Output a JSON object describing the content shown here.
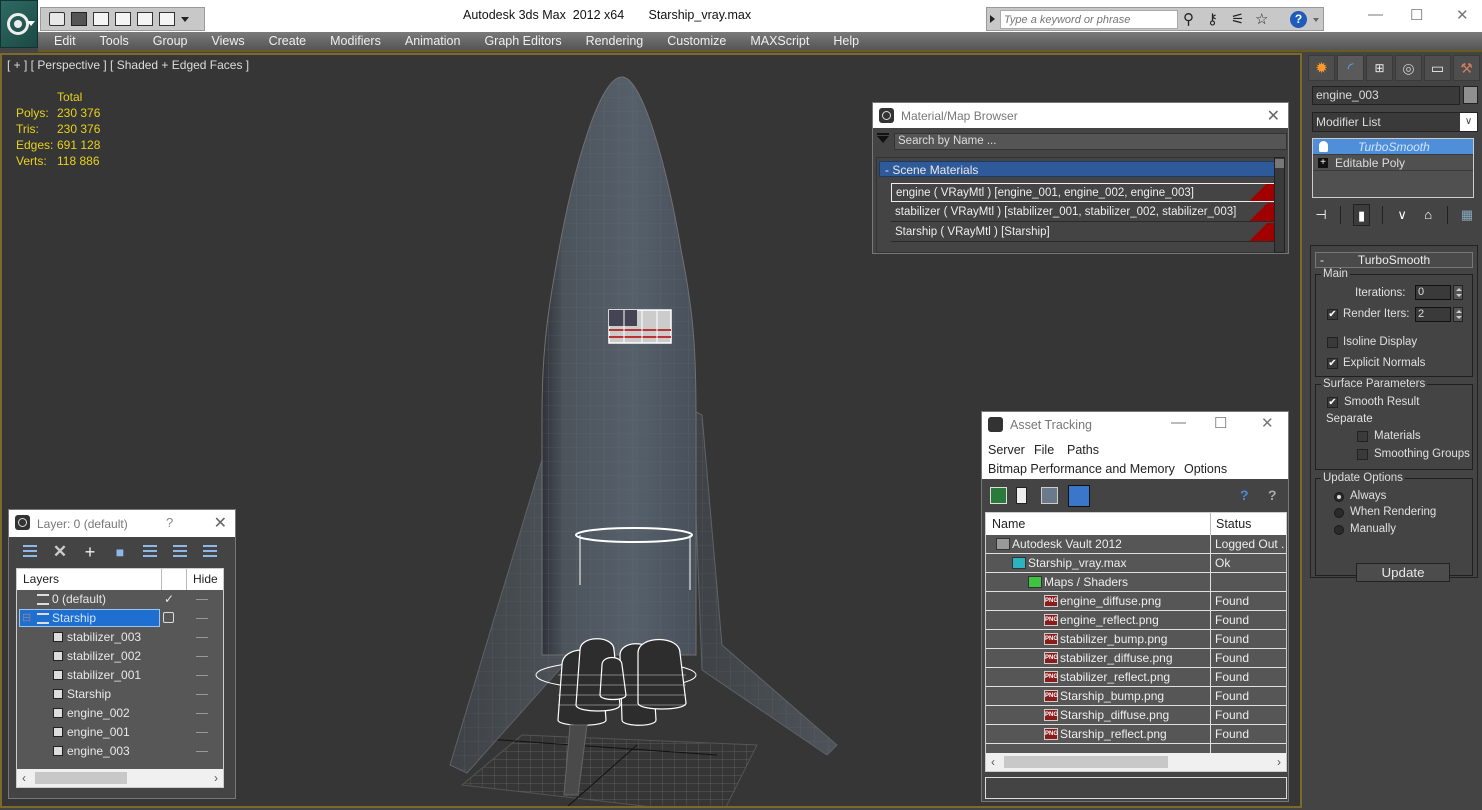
{
  "app": {
    "window_title": "Autodesk 3ds Max  2012 x64       Starship_vray.max",
    "search_placeholder": "Type a keyword or phrase",
    "window_controls": {
      "minimize": "—",
      "maximize": "☐",
      "close": "✕"
    }
  },
  "menu": [
    "Edit",
    "Tools",
    "Group",
    "Views",
    "Create",
    "Modifiers",
    "Animation",
    "Graph Editors",
    "Rendering",
    "Customize",
    "MAXScript",
    "Help"
  ],
  "viewport": {
    "label": "[ + ] [ Perspective ] [ Shaded + Edged Faces ]",
    "stats": {
      "header": "Total",
      "rows": [
        {
          "key": "Polys:",
          "value": "230 376"
        },
        {
          "key": "Tris:",
          "value": "230 376"
        },
        {
          "key": "Edges:",
          "value": "691 128"
        },
        {
          "key": "Verts:",
          "value": "118 886"
        }
      ]
    }
  },
  "material_browser": {
    "title": "Material/Map Browser",
    "search_placeholder": "Search by Name ...",
    "group_label": "- Scene Materials",
    "materials": [
      {
        "label": "engine  ( VRayMtl )  [engine_001, engine_002, engine_003]",
        "selected": true
      },
      {
        "label": "stabilizer  ( VRayMtl ) [stabilizer_001, stabilizer_002, stabilizer_003]",
        "selected": false
      },
      {
        "label": "Starship  ( VRayMtl )  [Starship]",
        "selected": false
      }
    ],
    "swatch_color": "#a00000"
  },
  "command_panel": {
    "object_name": "engine_003",
    "modifier_list_label": "Modifier List",
    "stack": [
      {
        "label": "TurboSmooth",
        "selected": true
      },
      {
        "label": "Editable Poly",
        "selected": false
      }
    ],
    "rollout": {
      "title": "TurboSmooth",
      "main_group": "Main",
      "iterations_label": "Iterations:",
      "iterations_value": "0",
      "render_iters_label": "Render Iters:",
      "render_iters_value": "2",
      "render_iters_checked": true,
      "isoline_label": "Isoline Display",
      "isoline_checked": false,
      "explicit_normals_label": "Explicit Normals",
      "explicit_normals_checked": true,
      "surface_group": "Surface Parameters",
      "smooth_result_label": "Smooth Result",
      "smooth_result_checked": true,
      "separate_label": "Separate",
      "materials_label": "Materials",
      "materials_checked": false,
      "smoothing_groups_label": "Smoothing Groups",
      "smoothing_groups_checked": false,
      "update_group": "Update Options",
      "update_options": [
        "Always",
        "When Rendering",
        "Manually"
      ],
      "update_selected": "Always",
      "update_button": "Update"
    }
  },
  "layer_dialog": {
    "title": "Layer: 0 (default)",
    "help": "?",
    "close": "✕",
    "columns": [
      "Layers",
      "",
      "Hide"
    ],
    "rows": [
      {
        "name": "0 (default)",
        "type": "layer",
        "active": true,
        "selected": false,
        "indent": 1
      },
      {
        "name": "Starship",
        "type": "layer",
        "active": false,
        "selected": true,
        "indent": 1
      },
      {
        "name": "stabilizer_003",
        "type": "object",
        "indent": 2
      },
      {
        "name": "stabilizer_002",
        "type": "object",
        "indent": 2
      },
      {
        "name": "stabilizer_001",
        "type": "object",
        "indent": 2
      },
      {
        "name": "Starship",
        "type": "object",
        "indent": 2
      },
      {
        "name": "engine_002",
        "type": "object",
        "indent": 2
      },
      {
        "name": "engine_001",
        "type": "object",
        "indent": 2
      },
      {
        "name": "engine_003",
        "type": "object",
        "indent": 2
      }
    ]
  },
  "asset_tracking": {
    "title": "Asset Tracking",
    "menu_row1": [
      "Server",
      "File",
      "Paths"
    ],
    "menu_row2": [
      "Bitmap Performance and Memory",
      "Options"
    ],
    "columns": [
      "Name",
      "Status"
    ],
    "rows": [
      {
        "name": "Autodesk Vault 2012",
        "status": "Logged Out .",
        "icon": "vault",
        "indent": 1
      },
      {
        "name": "Starship_vray.max",
        "status": "Ok",
        "icon": "max-file",
        "indent": 2
      },
      {
        "name": "Maps / Shaders",
        "status": "",
        "icon": "maps",
        "indent": 3
      },
      {
        "name": "engine_diffuse.png",
        "status": "Found",
        "icon": "png",
        "indent": 4
      },
      {
        "name": "engine_reflect.png",
        "status": "Found",
        "icon": "png",
        "indent": 4
      },
      {
        "name": "stabilizer_bump.png",
        "status": "Found",
        "icon": "png",
        "indent": 4
      },
      {
        "name": "stabilizer_diffuse.png",
        "status": "Found",
        "icon": "png",
        "indent": 4
      },
      {
        "name": "stabilizer_reflect.png",
        "status": "Found",
        "icon": "png",
        "indent": 4
      },
      {
        "name": "Starship_bump.png",
        "status": "Found",
        "icon": "png",
        "indent": 4
      },
      {
        "name": "Starship_diffuse.png",
        "status": "Found",
        "icon": "png",
        "indent": 4
      },
      {
        "name": "Starship_reflect.png",
        "status": "Found",
        "icon": "png",
        "indent": 4
      }
    ],
    "png_icon_text": "PNG"
  },
  "colors": {
    "stats_text": "#e6d21c",
    "viewport_bg": "#363636",
    "viewport_border": "#7d6a2a",
    "selection_blue": "#1f6fd1",
    "stack_selection": "#4f8fd9",
    "scene_materials_header": "#2f5a99"
  }
}
